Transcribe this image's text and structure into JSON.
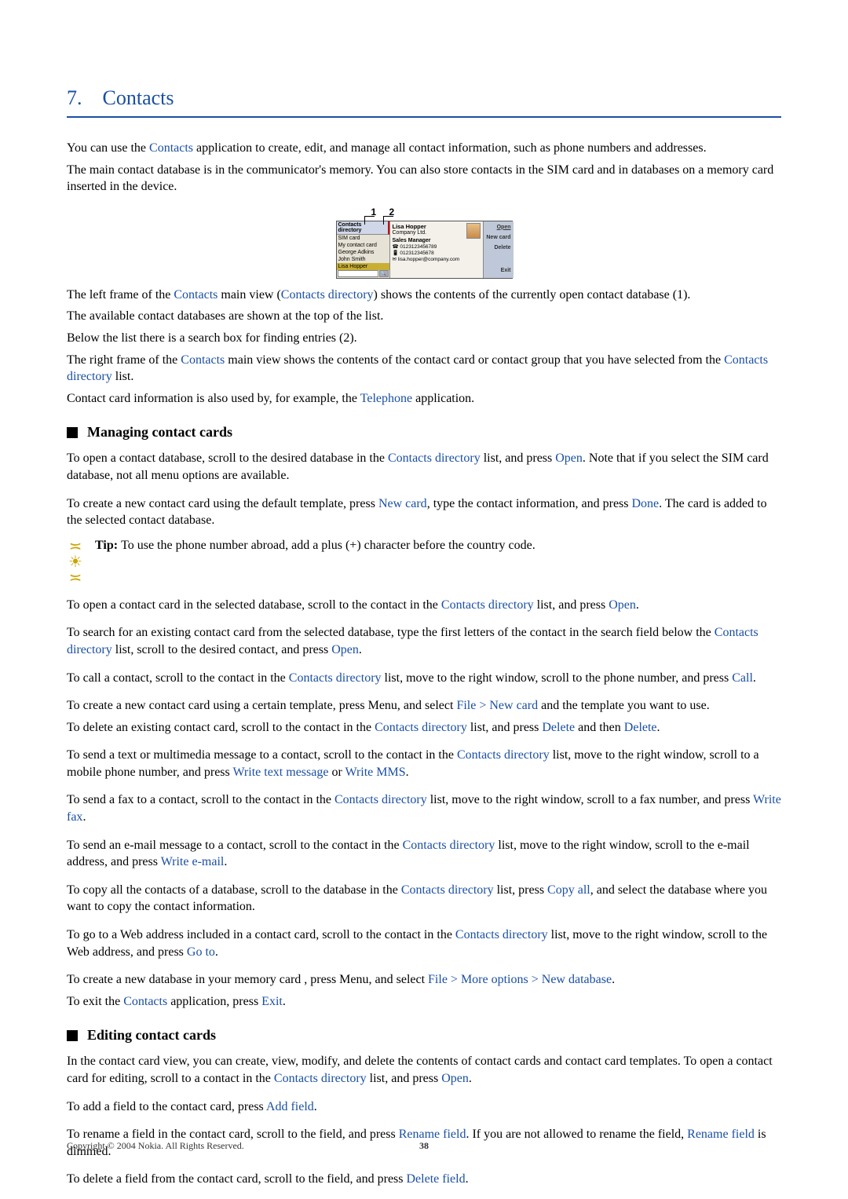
{
  "chapter": {
    "number": "7.",
    "title": "Contacts"
  },
  "intro": {
    "p1a": "You can use the ",
    "p1_link": "Contacts",
    "p1b": " application to create, edit, and manage all contact information, such as phone numbers and addresses.",
    "p2": "The main contact database is in the communicator's memory. You can also store contacts in the SIM card and in databases on a memory card inserted in the device."
  },
  "figure": {
    "callout1": "1",
    "callout2": "2",
    "header": "Contacts directory",
    "left_items": [
      "SIM card",
      "My contact card",
      "George Adkins",
      "John Smith",
      "Lisa Hopper"
    ],
    "selected_index": 4,
    "search_icon": "🔍",
    "right": {
      "name": "Lisa Hopper",
      "company": "Company Ltd.",
      "role": "Sales Manager",
      "rows": [
        "☎ 0123123456789",
        "📱 012312345678",
        "✉ lisa.hopper@company.com"
      ]
    },
    "buttons": [
      "Open",
      "New card",
      "Delete",
      "Exit"
    ]
  },
  "after_fig": {
    "p1a": "The left frame of the ",
    "p1_l1": "Contacts",
    "p1b": " main view (",
    "p1_l2": "Contacts directory",
    "p1c": ") shows the contents of the currently open contact database (1).",
    "p2": "The available contact databases are shown at the top of the list.",
    "p3": "Below the list there is a search box for finding entries (2).",
    "p4a": "The right frame of the ",
    "p4_l1": "Contacts",
    "p4b": " main view shows the contents of the contact card or contact group that you have selected from the ",
    "p4_l2": "Contacts directory",
    "p4c": " list.",
    "p5a": "Contact card information is also used by, for example, the ",
    "p5_l1": "Telephone",
    "p5b": " application."
  },
  "sec1": {
    "title": "Managing contact cards"
  },
  "manage": {
    "p1a": "To open a contact database, scroll to the desired database in the ",
    "p1_l1": "Contacts directory",
    "p1b": " list, and press ",
    "p1_l2": "Open",
    "p1c": ". Note that if you select the SIM card database, not all menu options are available.",
    "p2a": "To create a new contact card using the default template, press ",
    "p2_l1": "New card",
    "p2b": ", type the contact information, and press ",
    "p2_l2": "Done",
    "p2c": ". The card is added to the selected contact database.",
    "tip_label": "Tip: ",
    "tip_text": "To use the phone number abroad, add a plus (+) character before the country code.",
    "p3a": "To open a contact card in the selected database, scroll to the contact in the ",
    "p3_l1": "Contacts directory",
    "p3b": " list, and press ",
    "p3_l2": "Open",
    "p3c": ".",
    "p4a": "To search for an existing contact card from the selected database, type the first letters of the contact in the search field below the ",
    "p4_l1": "Contacts directory",
    "p4b": " list, scroll to the desired contact, and press ",
    "p4_l2": "Open",
    "p4c": ".",
    "p5a": "To call a contact, scroll to the contact in the ",
    "p5_l1": "Contacts directory",
    "p5b": " list, move to the right window, scroll to the phone number, and press ",
    "p5_l2": "Call",
    "p5c": ".",
    "p6a": "To create a new contact card using a certain template, press Menu, and select ",
    "p6_l1": "File",
    "p6b": " > ",
    "p6_l2": "New card",
    "p6c": " and the template you want to use.",
    "p7a": "To delete an existing contact card, scroll to the contact in the ",
    "p7_l1": "Contacts directory",
    "p7b": " list, and press ",
    "p7_l2": "Delete",
    "p7c": " and then ",
    "p7_l3": "Delete",
    "p7d": ".",
    "p8a": "To send a text or multimedia message to a contact, scroll to the contact in the ",
    "p8_l1": "Contacts directory",
    "p8b": " list, move to the right window, scroll to a mobile phone number, and press ",
    "p8_l2": "Write text message",
    "p8c": " or ",
    "p8_l3": "Write MMS",
    "p8d": ".",
    "p9a": "To send a fax to a contact, scroll to the contact in the ",
    "p9_l1": "Contacts directory",
    "p9b": " list, move to the right window, scroll to a fax number, and press ",
    "p9_l2": "Write fax",
    "p9c": ".",
    "p10a": "To send an e-mail message to a contact, scroll to the contact in the ",
    "p10_l1": "Contacts directory",
    "p10b": " list, move to the right window, scroll to the e-mail address, and press ",
    "p10_l2": "Write e-mail",
    "p10c": ".",
    "p11a": "To copy all the contacts of a database, scroll to the database in the ",
    "p11_l1": "Contacts directory",
    "p11b": " list, press ",
    "p11_l2": "Copy all",
    "p11c": ", and select the database where you want to copy the contact information.",
    "p12a": "To go to a Web address included in a contact card, scroll to the contact in the ",
    "p12_l1": "Contacts directory",
    "p12b": " list, move to the right window, scroll to the Web address, and press ",
    "p12_l2": "Go to",
    "p12c": ".",
    "p13a": "To create a new database in your memory card , press Menu, and select ",
    "p13_l1": "File",
    "p13b": " > ",
    "p13_l2": "More options",
    "p13c": " > ",
    "p13_l3": "New database",
    "p13d": ".",
    "p14a": "To exit the ",
    "p14_l1": "Contacts",
    "p14b": " application, press ",
    "p14_l2": "Exit",
    "p14c": "."
  },
  "sec2": {
    "title": "Editing contact cards"
  },
  "edit": {
    "p1a": "In the contact card view, you can create, view, modify, and delete the contents of contact cards and contact card templates. To open a contact card for editing, scroll to a contact in the ",
    "p1_l1": "Contacts directory",
    "p1b": " list, and press ",
    "p1_l2": "Open",
    "p1c": ".",
    "p2a": "To add a field to the contact card, press ",
    "p2_l1": "Add field",
    "p2b": ".",
    "p3a": "To rename a field in the contact card, scroll to the field, and press ",
    "p3_l1": "Rename field",
    "p3b": ". If you are not allowed to rename the field, ",
    "p3_l2": "Rename field",
    "p3c": " is dimmed.",
    "p4a": "To delete a field from the contact card, scroll to the field, and press ",
    "p4_l1": "Delete field",
    "p4b": "."
  },
  "footer": {
    "copyright": "Copyright © 2004 Nokia. All Rights Reserved.",
    "page": "38"
  }
}
